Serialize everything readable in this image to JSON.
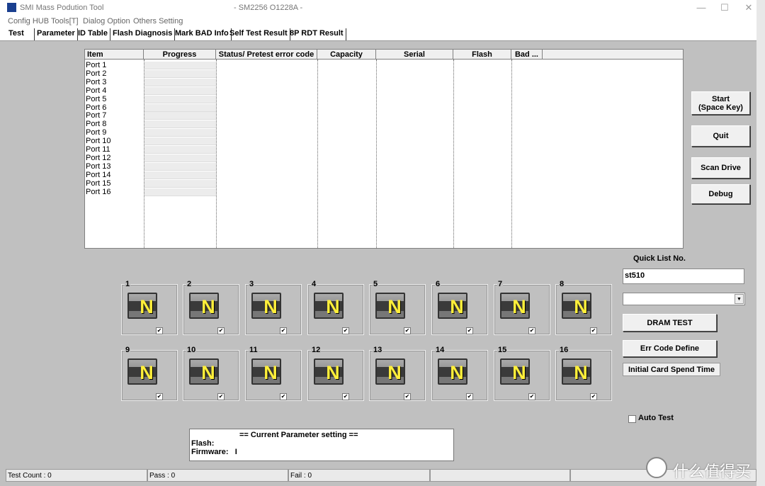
{
  "window": {
    "title": "SMI Mass Podution Tool",
    "subtitle": "- SM2256 O1228A -"
  },
  "menu": [
    "Config HUB",
    "Tools[T]",
    "Dialog Option",
    "Others Setting"
  ],
  "tabs": [
    "Test",
    "Parameter",
    "ID Table",
    "Flash Diagnosis",
    "Mark BAD Info",
    "Self Test Result",
    "8P RDT Result"
  ],
  "table": {
    "columns": [
      "Item",
      "Progress",
      "Status/ Pretest error code",
      "Capacity",
      "Serial",
      "Flash",
      "Bad ..."
    ],
    "rows": [
      "Port 1",
      "Port 2",
      "Port 3",
      "Port 4",
      "Port 5",
      "Port 6",
      "Port 7",
      "Port 8",
      "Port 9",
      "Port 10",
      "Port 11",
      "Port 12",
      "Port 13",
      "Port 14",
      "Port 15",
      "Port 16"
    ]
  },
  "ports": [
    {
      "num": "1",
      "state": "N",
      "checked": true
    },
    {
      "num": "2",
      "state": "N",
      "checked": true
    },
    {
      "num": "3",
      "state": "N",
      "checked": true
    },
    {
      "num": "4",
      "state": "N",
      "checked": true
    },
    {
      "num": "5",
      "state": "N",
      "checked": true
    },
    {
      "num": "6",
      "state": "N",
      "checked": true
    },
    {
      "num": "7",
      "state": "N",
      "checked": true
    },
    {
      "num": "8",
      "state": "N",
      "checked": true
    },
    {
      "num": "9",
      "state": "N",
      "checked": true
    },
    {
      "num": "10",
      "state": "N",
      "checked": true
    },
    {
      "num": "11",
      "state": "N",
      "checked": true
    },
    {
      "num": "12",
      "state": "N",
      "checked": true
    },
    {
      "num": "13",
      "state": "N",
      "checked": true
    },
    {
      "num": "14",
      "state": "N",
      "checked": true
    },
    {
      "num": "15",
      "state": "N",
      "checked": true
    },
    {
      "num": "16",
      "state": "N",
      "checked": true
    }
  ],
  "buttons": {
    "start_line1": "Start",
    "start_line2": "(Space Key)",
    "quit": "Quit",
    "scan": "Scan Drive",
    "debug": "Debug",
    "dram": "DRAM TEST",
    "err": "Err Code Define",
    "initial": "Initial Card Spend Time"
  },
  "quicklist": {
    "label": "Quick List No.",
    "value": "st510",
    "dropdown_value": ""
  },
  "auto_test": {
    "label": "Auto Test",
    "checked": false
  },
  "param": {
    "heading": "== Current Parameter setting ==",
    "flash_label": "Flash:",
    "flash_value": "",
    "firmware_label": "Firmware:",
    "firmware_value": "I"
  },
  "status": {
    "test_count": "Test Count : 0",
    "pass": "Pass : 0",
    "fail": "Fail : 0"
  },
  "watermark": "什么值得买"
}
